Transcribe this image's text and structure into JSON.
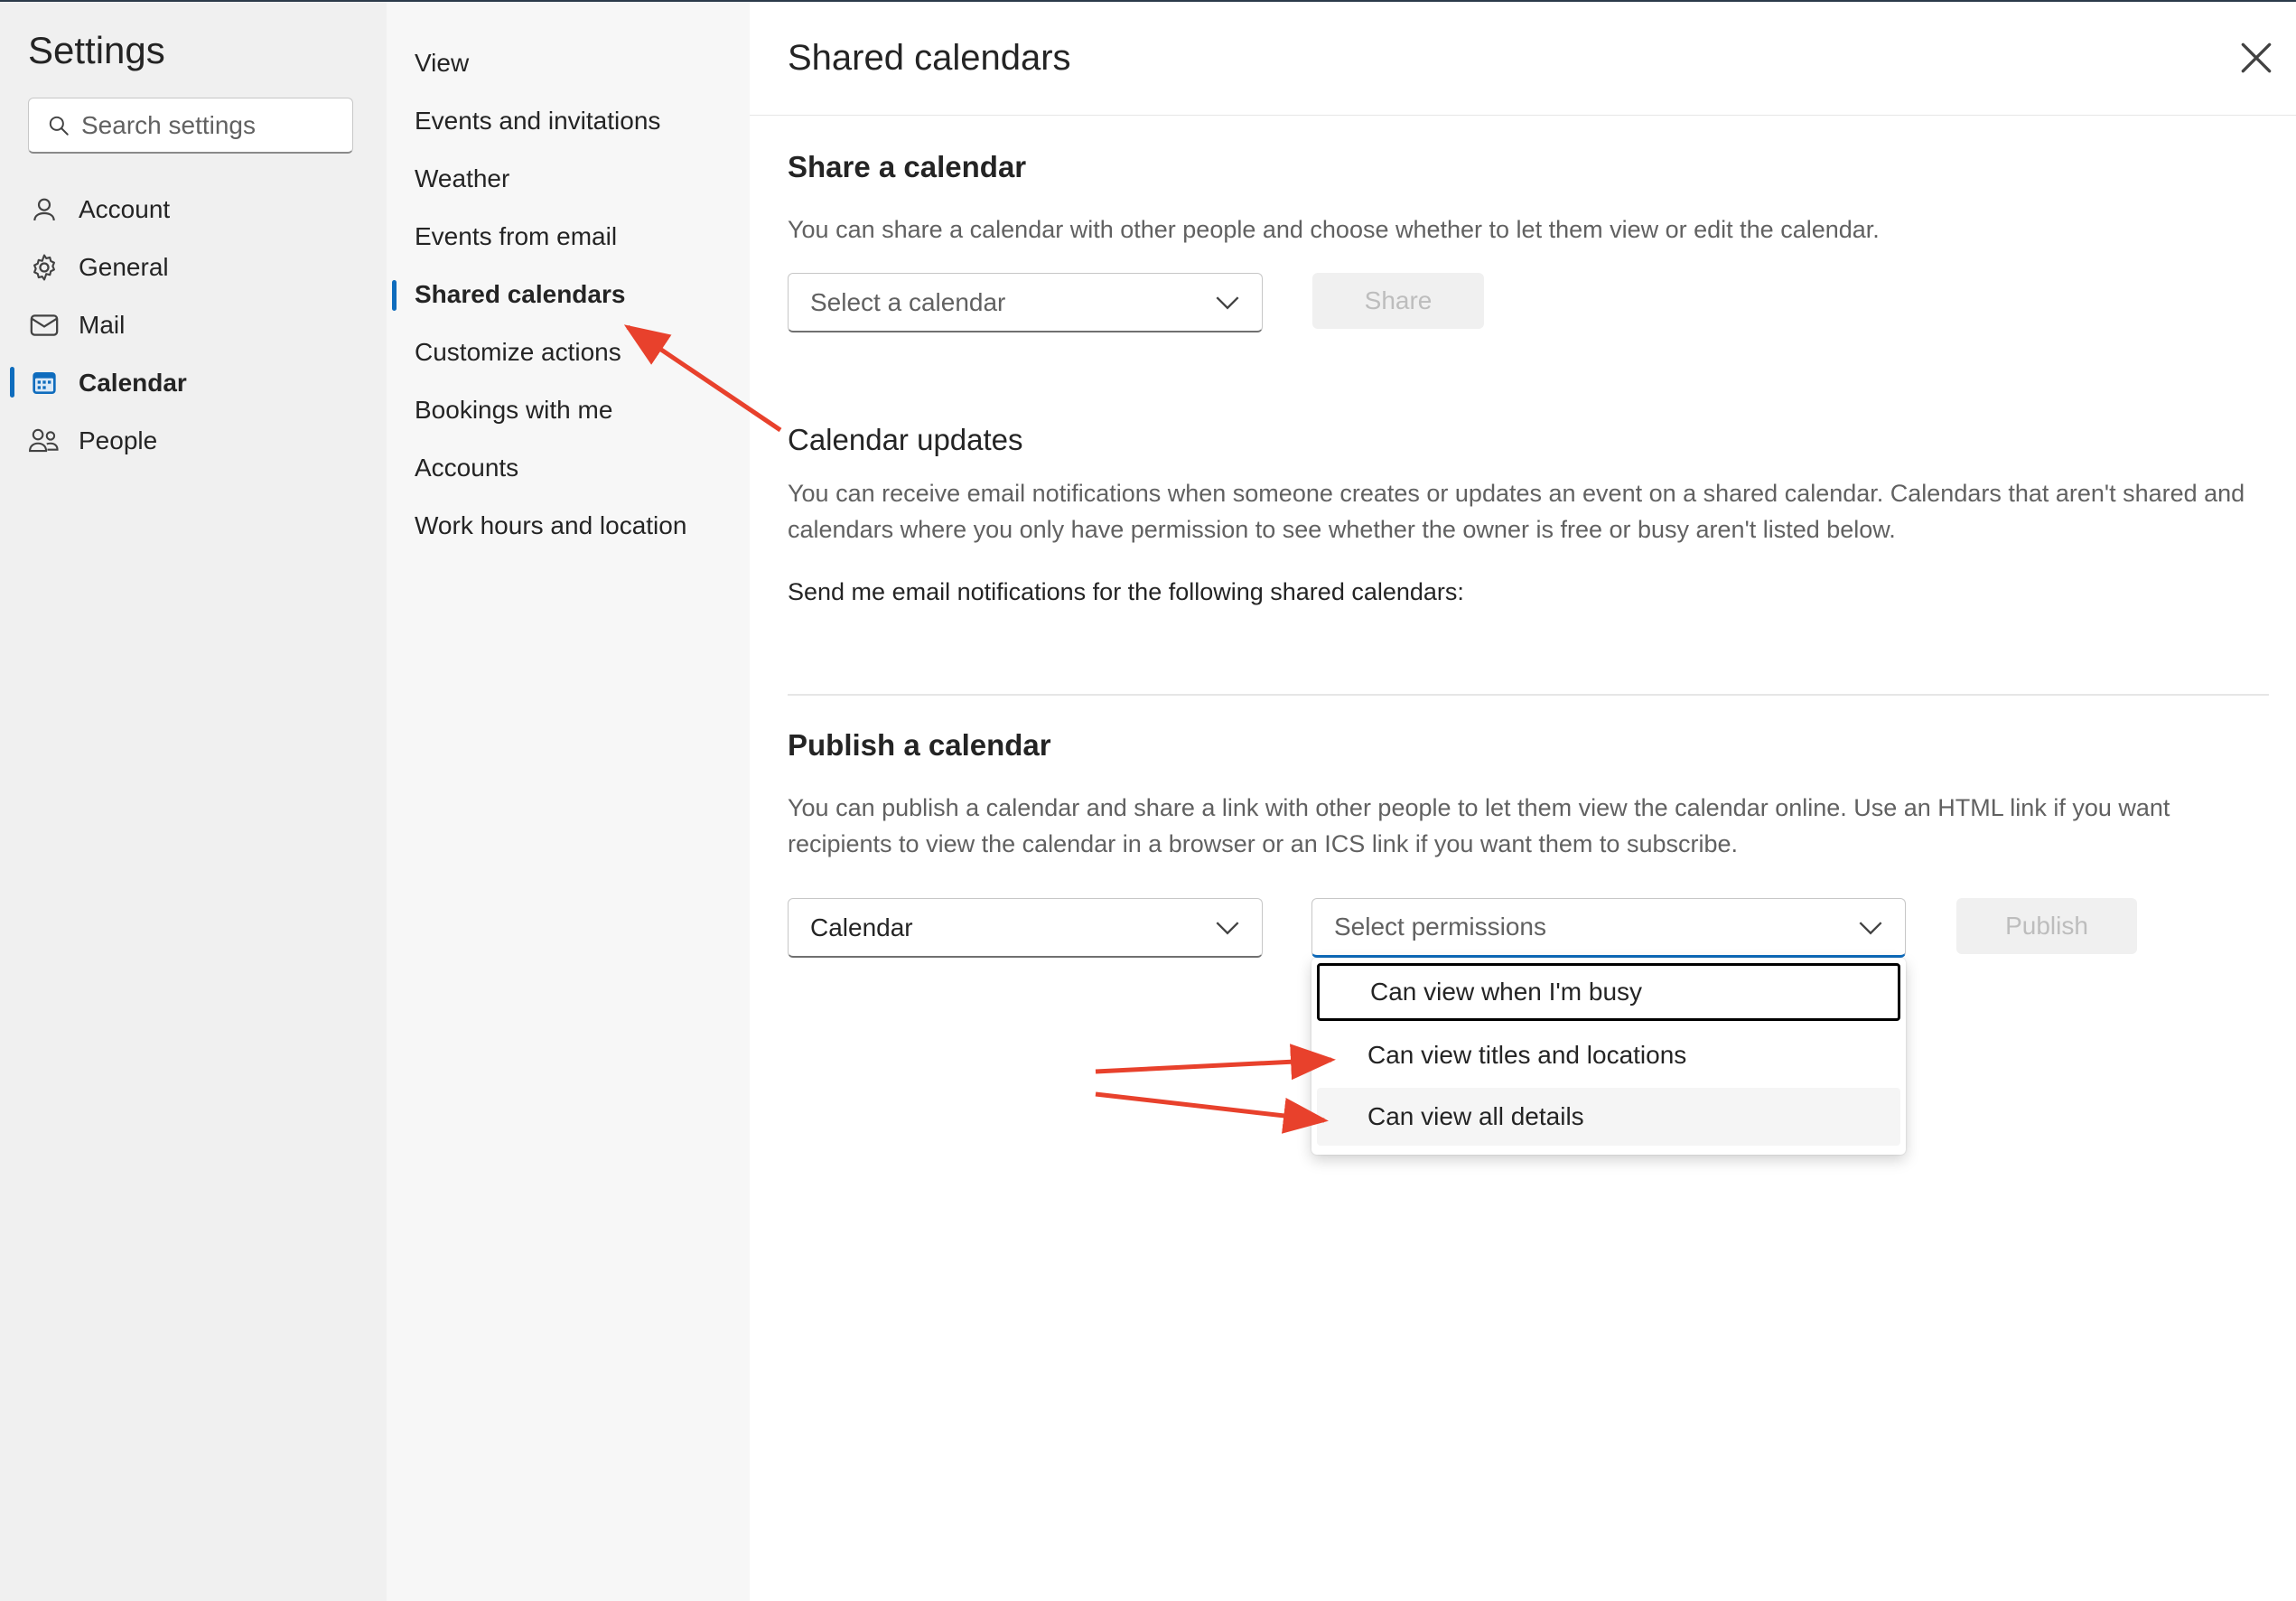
{
  "settings": {
    "title": "Settings",
    "search_placeholder": "Search settings",
    "nav": [
      {
        "label": "Account",
        "icon": "person-icon"
      },
      {
        "label": "General",
        "icon": "gear-icon"
      },
      {
        "label": "Mail",
        "icon": "mail-icon"
      },
      {
        "label": "Calendar",
        "icon": "calendar-icon",
        "active": true
      },
      {
        "label": "People",
        "icon": "people-icon"
      }
    ]
  },
  "subnav": {
    "items": [
      {
        "label": "View"
      },
      {
        "label": "Events and invitations"
      },
      {
        "label": "Weather"
      },
      {
        "label": "Events from email"
      },
      {
        "label": "Shared calendars",
        "active": true
      },
      {
        "label": "Customize actions"
      },
      {
        "label": "Bookings with me"
      },
      {
        "label": "Accounts"
      },
      {
        "label": "Work hours and location"
      }
    ]
  },
  "main": {
    "title": "Shared calendars",
    "share": {
      "title": "Share a calendar",
      "description": "You can share a calendar with other people and choose whether to let them view or edit the calendar.",
      "select_placeholder": "Select a calendar",
      "button": "Share"
    },
    "updates": {
      "title": "Calendar updates",
      "description": "You can receive email notifications when someone creates or updates an event on a shared calendar. Calendars that aren't shared and calendars where you only have permission to see whether the owner is free or busy aren't listed below.",
      "notify_label": "Send me email notifications for the following shared calendars:"
    },
    "publish": {
      "title": "Publish a calendar",
      "description": "You can publish a calendar and share a link with other people to let them view the calendar online. Use an HTML link if you want recipients to view the calendar in a browser or an ICS link if you want them to subscribe.",
      "calendar_value": "Calendar",
      "permissions_placeholder": "Select permissions",
      "button": "Publish",
      "permission_options": [
        "Can view when I'm busy",
        "Can view titles and locations",
        "Can view all details"
      ]
    }
  },
  "colors": {
    "accent": "#0f6cbd",
    "annotation_arrow": "#e8412c"
  }
}
